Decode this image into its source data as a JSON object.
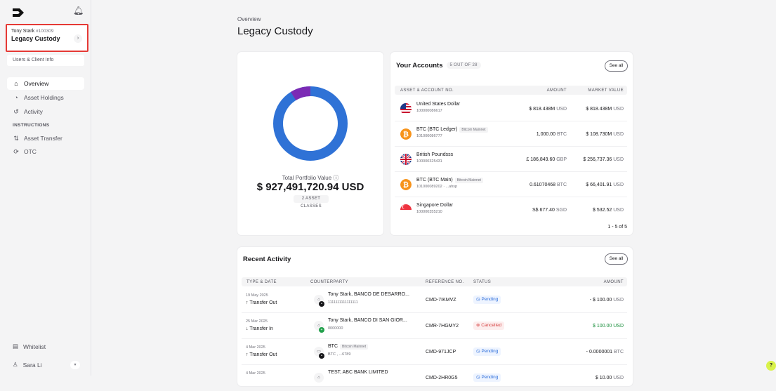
{
  "sidebar": {
    "client_name": "Tony Stark",
    "client_id": "#100309",
    "client_title": "Legacy Custody",
    "users_link": "Users & Client Info",
    "items": [
      {
        "label": "Overview",
        "icon": "home-icon"
      },
      {
        "label": "Asset Holdings",
        "icon": "pie-icon"
      },
      {
        "label": "Activity",
        "icon": "history-icon"
      },
      {
        "label": "Asset Transfer",
        "icon": "transfer-icon"
      },
      {
        "label": "OTC",
        "icon": "refresh-icon"
      }
    ],
    "section_label": "INSTRUCTIONS",
    "whitelist": "Whitelist",
    "user_name": "Sara Li"
  },
  "header": {
    "breadcrumb": "Overview",
    "title": "Legacy Custody"
  },
  "portfolio": {
    "label": "Total Portfolio Value",
    "value": "$ 927,491,720.94 USD",
    "badge": "2 ASSET CLASSES",
    "colors": {
      "primary": "#2f72d6",
      "secondary": "#7b2bb5"
    },
    "secondary_fraction": 0.09
  },
  "accounts": {
    "title": "Your Accounts",
    "count": "5 OUT OF 28",
    "see_all": "See all",
    "columns": {
      "asset": "ASSET & ACCOUNT NO.",
      "amount": "AMOUNT",
      "market": "MARKET VALUE"
    },
    "rows": [
      {
        "name": "United States Dollar",
        "badge": "",
        "no": "100000086617",
        "amount": "$ 818.438M",
        "amount_unit": "USD",
        "market": "$ 818.438M",
        "market_unit": "USD"
      },
      {
        "name": "BTC (BTC Ledger)",
        "badge": "Bitcoin Mainnet",
        "no": "101000086777",
        "amount": "1,000.00",
        "amount_unit": "BTC",
        "market": "$ 108.730M",
        "market_unit": "USD"
      },
      {
        "name": "British Poundsss",
        "badge": "",
        "no": "100000325431",
        "amount": "£ 186,849.60",
        "amount_unit": "GBP",
        "market": "$ 256,737.36",
        "market_unit": "USD"
      },
      {
        "name": "BTC (BTC Main)",
        "badge": "Bitcoin Mainnet",
        "no": "101000089202 · ...ahsp",
        "amount": "0.61070468",
        "amount_unit": "BTC",
        "market": "$ 66,401.91",
        "market_unit": "USD"
      },
      {
        "name": "Singapore Dollar",
        "badge": "",
        "no": "100000355210",
        "amount": "S$ 677.40",
        "amount_unit": "SGD",
        "market": "$ 532.52",
        "market_unit": "USD"
      }
    ],
    "pager": "1 - 5 of 5"
  },
  "activity": {
    "title": "Recent Activity",
    "see_all": "See all",
    "columns": {
      "type": "TYPE & DATE",
      "counterparty": "COUNTERPARTY",
      "ref": "REFERENCE NO.",
      "status": "STATUS",
      "amount": "AMOUNT"
    },
    "rows": [
      {
        "date": "19 May 2025",
        "type": "↑ Transfer Out",
        "cp": "Tony Stark, BANCO DE DESARRO...",
        "cp_sub": "1111111111111111",
        "ref": "CMD-7IKMVZ",
        "status": "◷ Pending",
        "amount": "- $ 100.00",
        "unit": "USD"
      },
      {
        "date": "25 Mar 2025",
        "type": "↓ Transfer In",
        "cp": "Tony Stark, BANCO DI SAN GIOR...",
        "cp_sub": "0000000",
        "ref": "CMR-7HGMY2",
        "status": "⊗ Cancelled",
        "amount": "$ 100.00",
        "unit": "USD"
      },
      {
        "date": "4 Mar 2025",
        "type": "↑ Transfer Out",
        "cp": "BTC",
        "cp_badge": "Bitcoin Mainnet",
        "cp_sub": "BTC , ...6789",
        "ref": "CMD-971JCP",
        "status": "◷ Pending",
        "amount": "- 0.0000001",
        "unit": "BTC"
      },
      {
        "date": "4 Mar 2025",
        "type": "",
        "cp": "TEST, ABC BANK LIMITED",
        "cp_sub": "",
        "ref": "CMD-2HR0G5",
        "status": "◷ Pending",
        "amount": "$ 10.00",
        "unit": "USD"
      }
    ]
  }
}
